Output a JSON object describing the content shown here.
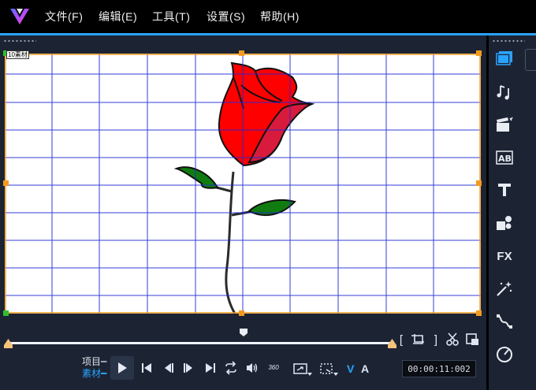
{
  "menu": {
    "items": [
      {
        "label": "文件(F)"
      },
      {
        "label": "编辑(E)"
      },
      {
        "label": "工具(T)"
      },
      {
        "label": "设置(S)"
      },
      {
        "label": "帮助(H)"
      }
    ]
  },
  "preview": {
    "corner_label": "10素材"
  },
  "controls": {
    "project_label": "项目",
    "clip_label": "素材",
    "timecode": "00:00:11:002",
    "btn_360": "360",
    "v_label": "V",
    "a_label": "A"
  },
  "colors": {
    "accent": "#2aa3ff",
    "panel_bg": "#1c2433",
    "grid_line": "#1f29d6",
    "rose_red": "#ff0000",
    "leaf_green": "#107c10",
    "handle_orange": "#f39a1e"
  }
}
